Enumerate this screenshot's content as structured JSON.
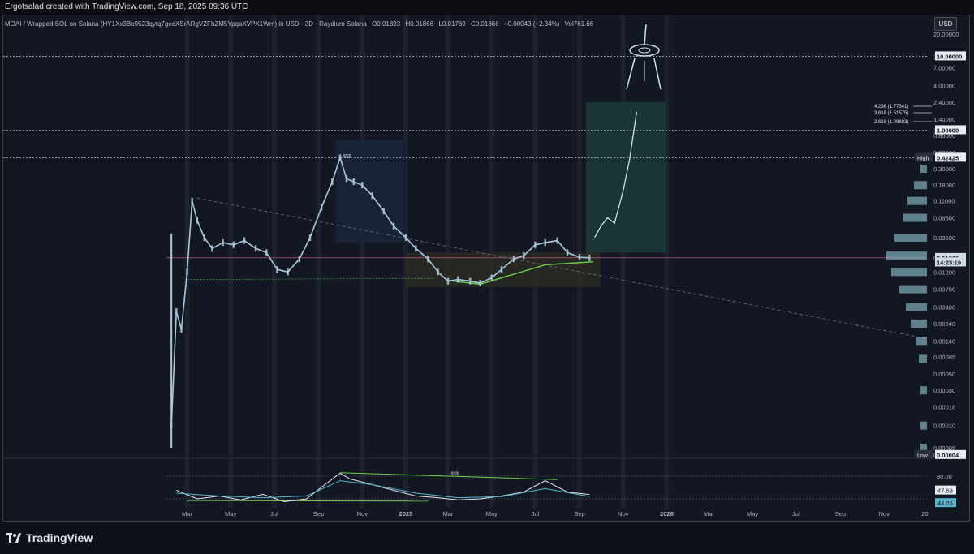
{
  "header": {
    "creator": "Ergotsalad created with TradingView.com, Sep 18, 2025 09:36 UTC"
  },
  "legend": {
    "symbol": "MOAI / Wrapped SOL on Solana (HY1Xx3Bo9523qytq7gceXSrARgVZFhZM5YpqaXVPX1Wm) in USD · 3D · Raydium Solana",
    "open": "O0.01823",
    "high": "H0.01866",
    "low": "L0.01769",
    "close": "C0.01866",
    "change": "+0.00043 (+2.34%)",
    "volume": "Vol761.66"
  },
  "currency": "USD",
  "brand": "TradingView",
  "colors": {
    "background": "#131722",
    "candle": "#a9c8d8",
    "green": "#4caf50",
    "teal_zone": "#1b3a36",
    "label_box": "#e8edf2"
  },
  "chart_data": [
    {
      "type": "line",
      "chart_label": "price",
      "y_scale": "log",
      "y_ticks": [
        "20.00000",
        "10.00000",
        "7.00000",
        "4.00000",
        "2.40000",
        "1.40000",
        "1.00000",
        "0.85000",
        "0.50000",
        "0.30000",
        "0.18000",
        "0.11000",
        "0.06500",
        "0.03500",
        "0.01866",
        "0.01200",
        "0.00700",
        "0.00400",
        "0.00240",
        "0.00140",
        "0.00085",
        "0.00050",
        "0.00030",
        "0.00018",
        "0.00010",
        "0.00005",
        "0.00004"
      ],
      "x_ticks": [
        "Mar",
        "May",
        "Jul",
        "Sep",
        "Nov",
        "2025",
        "Mar",
        "May",
        "Jul",
        "Sep",
        "Nov",
        "2026",
        "Mar",
        "May",
        "Jul",
        "Sep",
        "Nov",
        "20"
      ],
      "price_labels": [
        {
          "tag": "",
          "text": "10.00000",
          "value": 10.0
        },
        {
          "tag": "",
          "text": "1.00000",
          "value": 1.0
        },
        {
          "tag": "High",
          "text": "0.42425",
          "value": 0.42425
        },
        {
          "tag": "",
          "text": "0.01866",
          "value": 0.01866
        },
        {
          "tag": "",
          "text": "14:23:19",
          "value": 0.0162
        },
        {
          "tag": "Low",
          "text": "0.00004",
          "value": 4e-05
        }
      ],
      "fib_labels": [
        {
          "text": "4.236 (1.77341)",
          "value": 1.77341
        },
        {
          "text": "3.618 (1.51575)",
          "value": 1.51575
        },
        {
          "text": "2.618 (1.09883)",
          "value": 1.09883
        }
      ],
      "annotations": [
        "$$$",
        "$$$"
      ],
      "series": [
        {
          "name": "",
          "x": [
            "2024-02-08",
            "2024-02-15",
            "2024-02-22",
            "2024-03-01",
            "2024-03-08",
            "2024-03-15",
            "2024-03-25",
            "2024-04-05",
            "2024-04-20",
            "2024-05-05",
            "2024-05-20",
            "2024-06-05",
            "2024-06-20",
            "2024-07-05",
            "2024-07-20",
            "2024-08-05",
            "2024-08-20",
            "2024-09-05",
            "2024-09-20",
            "2024-10-01",
            "2024-10-10",
            "2024-10-20",
            "2024-11-01",
            "2024-11-15",
            "2024-12-01",
            "2024-12-15",
            "2025-01-01",
            "2025-01-15",
            "2025-02-01",
            "2025-02-15",
            "2025-03-01",
            "2025-03-15",
            "2025-04-01",
            "2025-04-15",
            "2025-05-01",
            "2025-05-15",
            "2025-06-01",
            "2025-06-15",
            "2025-07-01",
            "2025-07-15",
            "2025-08-01",
            "2025-08-15",
            "2025-09-01",
            "2025-09-15"
          ],
          "y": [
            0.0001,
            0.0035,
            0.002,
            0.012,
            0.11,
            0.06,
            0.035,
            0.025,
            0.03,
            0.028,
            0.032,
            0.025,
            0.022,
            0.013,
            0.012,
            0.018,
            0.035,
            0.09,
            0.2,
            0.424,
            0.22,
            0.2,
            0.18,
            0.13,
            0.08,
            0.05,
            0.035,
            0.025,
            0.018,
            0.012,
            0.009,
            0.0095,
            0.009,
            0.0085,
            0.01,
            0.013,
            0.018,
            0.02,
            0.028,
            0.03,
            0.032,
            0.022,
            0.019,
            0.0187
          ]
        },
        {
          "name": "",
          "x": [
            "2025-09-22",
            "2025-10-01",
            "2025-10-10",
            "2025-10-20",
            "2025-11-01",
            "2025-11-10",
            "2025-11-20"
          ],
          "y": [
            0.035,
            0.05,
            0.065,
            0.055,
            0.15,
            0.4,
            1.77
          ]
        }
      ]
    },
    {
      "type": "line",
      "chart_label": "oscillator",
      "y_ticks": [
        "80.00"
      ],
      "value_labels": [
        "47.69",
        "44.06"
      ],
      "series": [
        {
          "name": "",
          "x": [
            "2024-02-15",
            "2024-03-15",
            "2024-04-15",
            "2024-05-15",
            "2024-06-15",
            "2024-07-15",
            "2024-08-15",
            "2024-09-15",
            "2024-10-01",
            "2024-10-15",
            "2024-11-15",
            "2024-12-15",
            "2025-01-15",
            "2025-02-15",
            "2025-03-15",
            "2025-04-15",
            "2025-05-15",
            "2025-06-15",
            "2025-07-15",
            "2025-08-15",
            "2025-09-15"
          ],
          "y": [
            55,
            40,
            45,
            38,
            48,
            35,
            40,
            70,
            85,
            75,
            65,
            55,
            45,
            42,
            38,
            40,
            45,
            52,
            72,
            52,
            47.69
          ]
        },
        {
          "name": "",
          "x": [
            "2024-02-15",
            "2024-04-15",
            "2024-06-15",
            "2024-08-15",
            "2024-10-01",
            "2024-11-15",
            "2025-01-15",
            "2025-03-15",
            "2025-05-15",
            "2025-07-15",
            "2025-09-15"
          ],
          "y": [
            50,
            45,
            42,
            45,
            72,
            65,
            50,
            42,
            44,
            58,
            44.06
          ]
        }
      ]
    }
  ]
}
